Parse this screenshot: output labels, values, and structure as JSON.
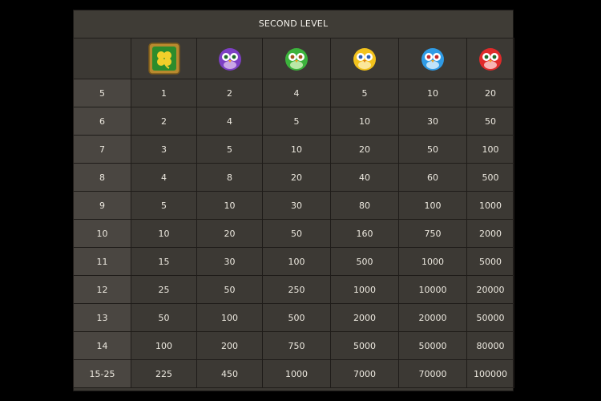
{
  "panel": {
    "title": "SECOND LEVEL"
  },
  "symbols": [
    {
      "icon": "clover-wild-icon",
      "frame": "#b9892e",
      "fill": "#2c8c2c",
      "accent": "#f2cf2a"
    },
    {
      "icon": "purple-bird-icon",
      "fill": "#7d3fc4"
    },
    {
      "icon": "green-bird-icon",
      "fill": "#3cb33c"
    },
    {
      "icon": "yellow-bird-icon",
      "fill": "#f2c21c"
    },
    {
      "icon": "blue-bird-icon",
      "fill": "#2f9be6"
    },
    {
      "icon": "red-bird-icon",
      "fill": "#e02a2a"
    }
  ],
  "rows": [
    {
      "count": "5",
      "values": [
        "1",
        "2",
        "4",
        "5",
        "10",
        "20"
      ]
    },
    {
      "count": "6",
      "values": [
        "2",
        "4",
        "5",
        "10",
        "30",
        "50"
      ]
    },
    {
      "count": "7",
      "values": [
        "3",
        "5",
        "10",
        "20",
        "50",
        "100"
      ]
    },
    {
      "count": "8",
      "values": [
        "4",
        "8",
        "20",
        "40",
        "60",
        "500"
      ]
    },
    {
      "count": "9",
      "values": [
        "5",
        "10",
        "30",
        "80",
        "100",
        "1000"
      ]
    },
    {
      "count": "10",
      "values": [
        "10",
        "20",
        "50",
        "160",
        "750",
        "2000"
      ]
    },
    {
      "count": "11",
      "values": [
        "15",
        "30",
        "100",
        "500",
        "1000",
        "5000"
      ]
    },
    {
      "count": "12",
      "values": [
        "25",
        "50",
        "250",
        "1000",
        "10000",
        "20000"
      ]
    },
    {
      "count": "13",
      "values": [
        "50",
        "100",
        "500",
        "2000",
        "20000",
        "50000"
      ]
    },
    {
      "count": "14",
      "values": [
        "100",
        "200",
        "750",
        "5000",
        "50000",
        "80000"
      ]
    },
    {
      "count": "15-25",
      "values": [
        "225",
        "450",
        "1000",
        "7000",
        "70000",
        "100000"
      ]
    }
  ]
}
